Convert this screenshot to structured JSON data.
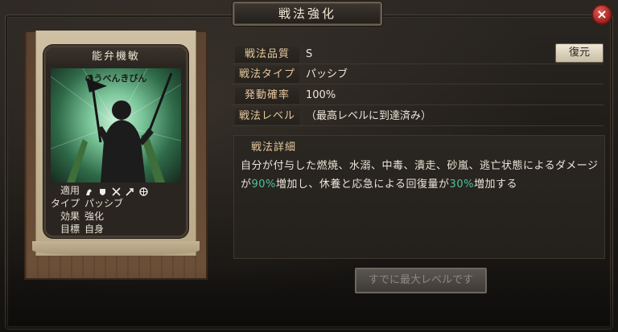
{
  "window": {
    "title": "戦法強化",
    "close_label": "×"
  },
  "card": {
    "name": "能弁機敏",
    "reading": "のうべんきびん",
    "stats": {
      "apply_key": "適用",
      "type_key": "タイプ",
      "type_val": "パッシブ",
      "effect_key": "効果",
      "effect_val": "強化",
      "target_key": "目標",
      "target_val": "自身"
    },
    "apply_icons": [
      "cavalry-icon",
      "shield-icon",
      "crossed-swords-icon",
      "arrow-icon",
      "wheel-icon"
    ]
  },
  "info": {
    "quality_label": "戦法品質",
    "quality_value": "S",
    "type_label": "戦法タイプ",
    "type_value": "パッシブ",
    "rate_label": "発動確率",
    "rate_value": "100%",
    "level_label": "戦法レベル",
    "level_value": "（最高レベルに到達済み）",
    "restore_label": "復元"
  },
  "detail": {
    "label": "戦法詳細",
    "text_part1": "自分が付与した燃焼、水溺、中毒、潰走、砂嵐、逃亡状態によるダメージが",
    "highlight1": "90%",
    "text_part2": "増加し、休養と応急による回復量が",
    "highlight2": "30%",
    "text_part3": "増加する",
    "highlight_color": "#4fc2a0"
  },
  "footer": {
    "max_label": "すでに最大レベルです"
  }
}
